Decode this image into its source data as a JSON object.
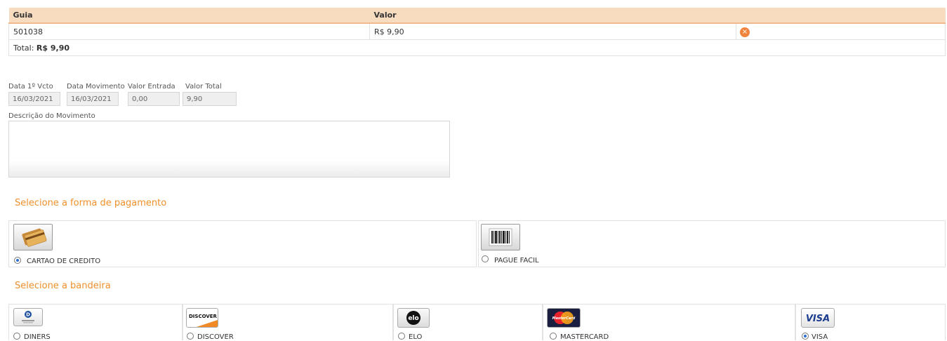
{
  "guias": {
    "headers": {
      "guia": "Guia",
      "valor": "Valor"
    },
    "rows": [
      {
        "guia": "501038",
        "valor": "R$ 9,90",
        "remove_icon": "×"
      }
    ],
    "total_label": "Total:",
    "total_value": "R$ 9,90"
  },
  "fields": {
    "data_vcto": {
      "label": "Data 1º Vcto",
      "value": "16/03/2021"
    },
    "data_movimento": {
      "label": "Data Movimento",
      "value": "16/03/2021"
    },
    "valor_entrada": {
      "label": "Valor Entrada",
      "value": "0,00"
    },
    "valor_total": {
      "label": "Valor Total",
      "value": "9,90"
    },
    "descricao": {
      "label": "Descrição do Movimento",
      "value": ""
    }
  },
  "payment": {
    "title": "Selecione a forma de pagamento",
    "options": [
      {
        "label": "CARTAO DE CREDITO",
        "icon": "credit-card-icon",
        "selected": true
      },
      {
        "label": "PAGUE FACIL",
        "icon": "barcode-icon",
        "selected": false
      }
    ]
  },
  "brands": {
    "title": "Selecione a bandeira",
    "options": [
      {
        "label": "DINERS",
        "logo_text": "D",
        "selected": false
      },
      {
        "label": "DISCOVER",
        "logo_text": "DISCOVER",
        "selected": false
      },
      {
        "label": "ELO",
        "logo_text": "elo",
        "selected": false
      },
      {
        "label": "MASTERCARD",
        "logo_text": "MasterCard",
        "selected": false
      },
      {
        "label": "VISA",
        "logo_text": "VISA",
        "selected": true
      }
    ]
  },
  "colors": {
    "accent": "#f0902a",
    "header_bg": "#f7dcc0",
    "remove": "#f0843c",
    "radio": "#2b6fd6"
  }
}
